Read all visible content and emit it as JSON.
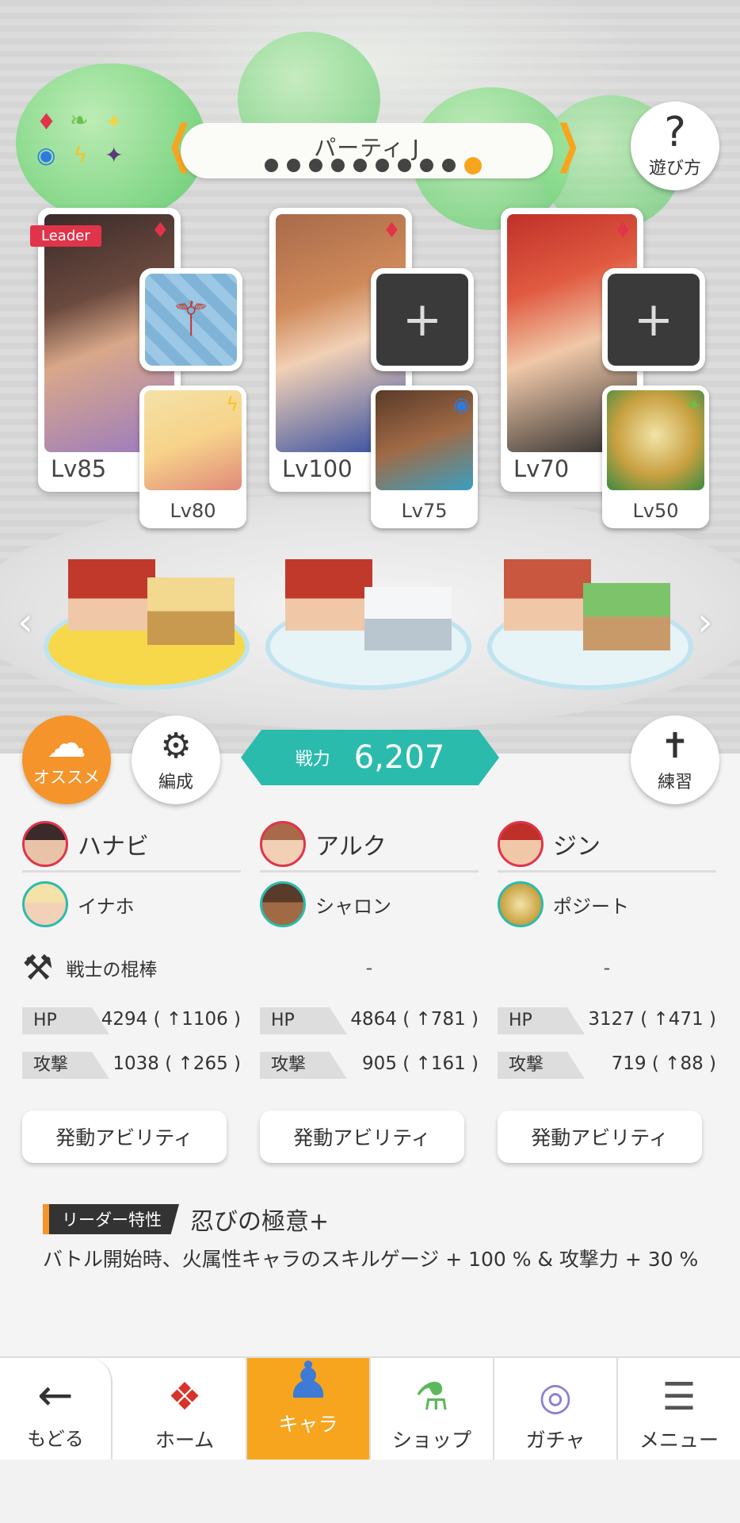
{
  "party": {
    "title": "パーティ J",
    "page_count": 10,
    "active_page": 10
  },
  "help_button": {
    "label": "遊び方",
    "glyph": "?"
  },
  "leader_tag": "Leader",
  "cards": [
    {
      "name": "ハナビ",
      "level": "Lv85",
      "sub_level": "Lv80",
      "sub_name": "イナホ",
      "equipment": "戦士の棍棒"
    },
    {
      "name": "アルク",
      "level": "Lv100",
      "sub_level": "Lv75",
      "sub_name": "シャロン",
      "equipment": "-"
    },
    {
      "name": "ジン",
      "level": "Lv70",
      "sub_level": "Lv50",
      "sub_name": "ポジート",
      "equipment": "-"
    }
  ],
  "recommend_button": {
    "label": "オススメ"
  },
  "formation_button": {
    "label": "編成"
  },
  "practice_button": {
    "label": "練習"
  },
  "combat_power": {
    "label": "戦力",
    "value": "6,207"
  },
  "stats": [
    {
      "hp_label": "HP",
      "hp_value": "4294 ( ↑1106 )",
      "atk_label": "攻撃",
      "atk_value": "1038 ( ↑265 )"
    },
    {
      "hp_label": "HP",
      "hp_value": "4864 ( ↑781 )",
      "atk_label": "攻撃",
      "atk_value": "905 ( ↑161 )"
    },
    {
      "hp_label": "HP",
      "hp_value": "3127 ( ↑471 )",
      "atk_label": "攻撃",
      "atk_value": "719 ( ↑88 )"
    }
  ],
  "ability_button_label": "発動アビリティ",
  "leader_skill": {
    "tag": "リーダー特性",
    "name": "忍びの極意+",
    "description": "バトル開始時、火属性キャラのスキルゲージ + 100 % & 攻撃力 + 30 %"
  },
  "nav": {
    "back_label": "もどる",
    "tabs": [
      {
        "label": "ホーム",
        "icon": "home-icon"
      },
      {
        "label": "キャラ",
        "icon": "character-icon",
        "active": true
      },
      {
        "label": "ショップ",
        "icon": "shop-icon"
      },
      {
        "label": "ガチャ",
        "icon": "gacha-icon"
      },
      {
        "label": "メニュー",
        "icon": "menu-icon"
      }
    ]
  },
  "colors": {
    "accent_orange": "#f7a51f",
    "teal": "#2bbbad",
    "fire_red": "#e0344a"
  }
}
